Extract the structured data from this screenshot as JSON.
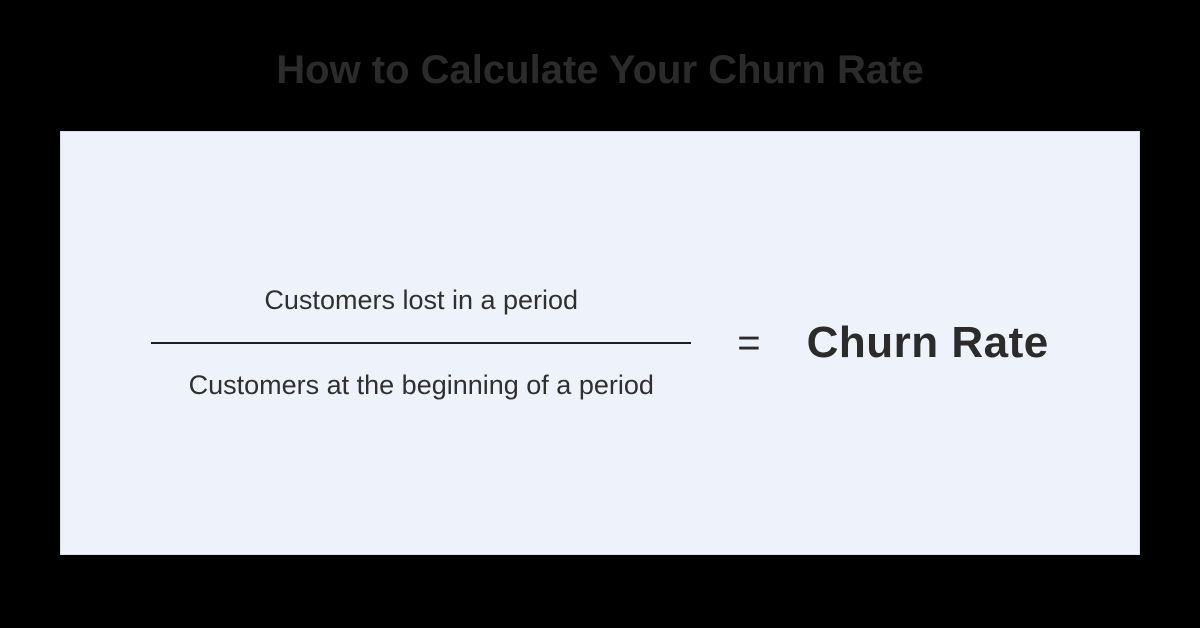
{
  "title": "How to Calculate Your Churn Rate",
  "formula": {
    "numerator": "Customers lost in a period",
    "denominator": "Customers at the beginning of a period",
    "equals": "=",
    "result": "Churn Rate"
  }
}
